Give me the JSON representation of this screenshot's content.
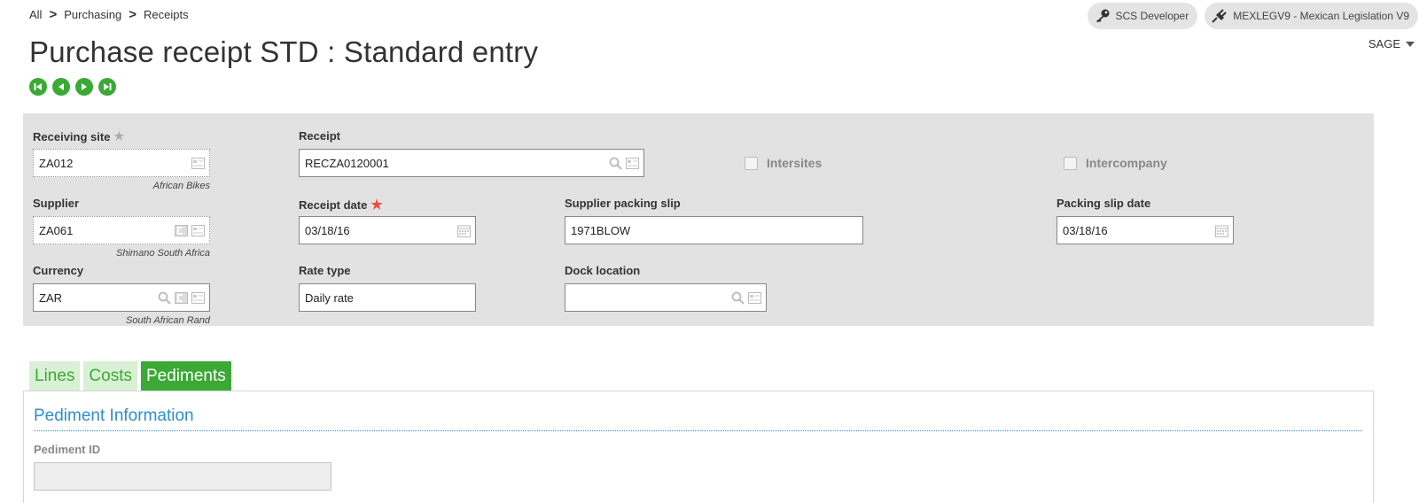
{
  "breadcrumb": {
    "root": "All",
    "items": [
      "Purchasing",
      "Receipts"
    ]
  },
  "header": {
    "role": "SCS Developer",
    "folder": "MEXLEGV9 - Mexican Legislation V9",
    "user": "SAGE"
  },
  "page_title": "Purchase receipt STD : Standard entry",
  "fields": {
    "receiving_site": {
      "label": "Receiving site",
      "value": "ZA012",
      "caption": "African Bikes"
    },
    "receipt": {
      "label": "Receipt",
      "value": "RECZA0120001"
    },
    "intersites": {
      "label": "Intersites"
    },
    "intercompany": {
      "label": "Intercompany"
    },
    "supplier": {
      "label": "Supplier",
      "value": "ZA061",
      "caption": "Shimano South Africa"
    },
    "receipt_date": {
      "label": "Receipt date",
      "value": "03/18/16"
    },
    "supplier_packing_slip": {
      "label": "Supplier packing slip",
      "value": "1971BLOW"
    },
    "packing_slip_date": {
      "label": "Packing slip date",
      "value": "03/18/16"
    },
    "currency": {
      "label": "Currency",
      "value": "ZAR",
      "caption": "South African Rand"
    },
    "rate_type": {
      "label": "Rate type",
      "value": "Daily rate"
    },
    "dock_location": {
      "label": "Dock location",
      "value": ""
    }
  },
  "tabs": [
    {
      "label": "Lines",
      "active": false
    },
    {
      "label": "Costs",
      "active": false
    },
    {
      "label": "Pediments",
      "active": true
    }
  ],
  "pediment": {
    "section_title": "Pediment Information",
    "id_label": "Pediment ID",
    "id_value": ""
  },
  "colors": {
    "accent_green": "#3aa935",
    "link_blue": "#2e8ec9",
    "required": "#e8523f"
  }
}
